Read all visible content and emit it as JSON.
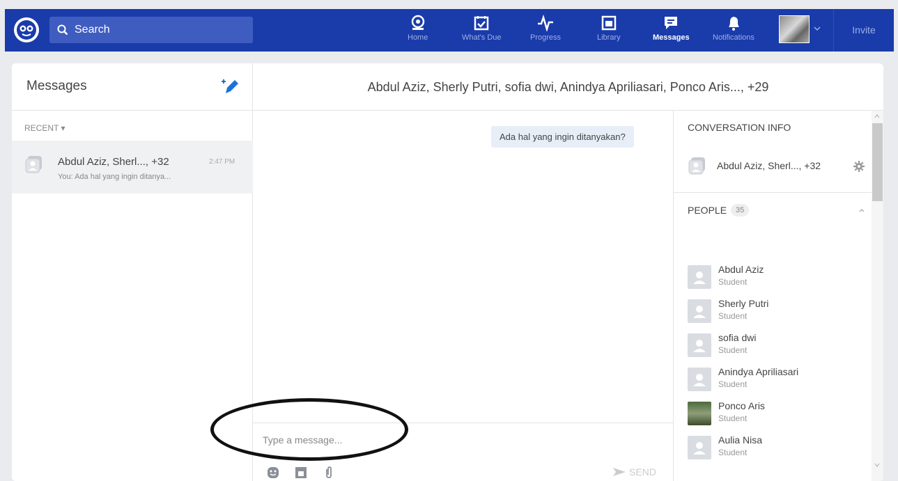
{
  "topbar": {
    "search_placeholder": "Search",
    "nav": [
      {
        "label": "Home",
        "icon": "home-icon"
      },
      {
        "label": "What's Due",
        "icon": "calendar-check-icon"
      },
      {
        "label": "Progress",
        "icon": "pulse-icon"
      },
      {
        "label": "Library",
        "icon": "library-icon"
      },
      {
        "label": "Messages",
        "icon": "messages-icon",
        "active": true
      },
      {
        "label": "Notifications",
        "icon": "bell-icon"
      }
    ],
    "invite_label": "Invite",
    "color": "#1a3baa"
  },
  "sidebar": {
    "title": "Messages",
    "recent_label": "RECENT",
    "conversations": [
      {
        "name": "Abdul Aziz, Sherl..., +32",
        "time": "2:47 PM",
        "preview": "You: Ada hal yang ingin ditanya..."
      }
    ]
  },
  "conversation": {
    "title": "Abdul Aziz, Sherly Putri, sofia dwi, Anindya Apriliasari, Ponco Aris..., +29",
    "messages": [
      {
        "text": "Ada hal yang ingin ditanyakan?"
      }
    ],
    "input_placeholder": "Type a message...",
    "send_label": "SEND"
  },
  "info": {
    "heading": "CONVERSATION INFO",
    "group_name": "Abdul Aziz, Sherl..., +32",
    "people_label": "PEOPLE",
    "people_count": "35",
    "people": [
      {
        "name": "Abdul Aziz",
        "role": "Student"
      },
      {
        "name": "Sherly Putri",
        "role": "Student"
      },
      {
        "name": "sofia dwi",
        "role": "Student"
      },
      {
        "name": "Anindya Apriliasari",
        "role": "Student"
      },
      {
        "name": "Ponco Aris",
        "role": "Student",
        "photo": true
      },
      {
        "name": "Aulia Nisa",
        "role": "Student"
      }
    ]
  }
}
